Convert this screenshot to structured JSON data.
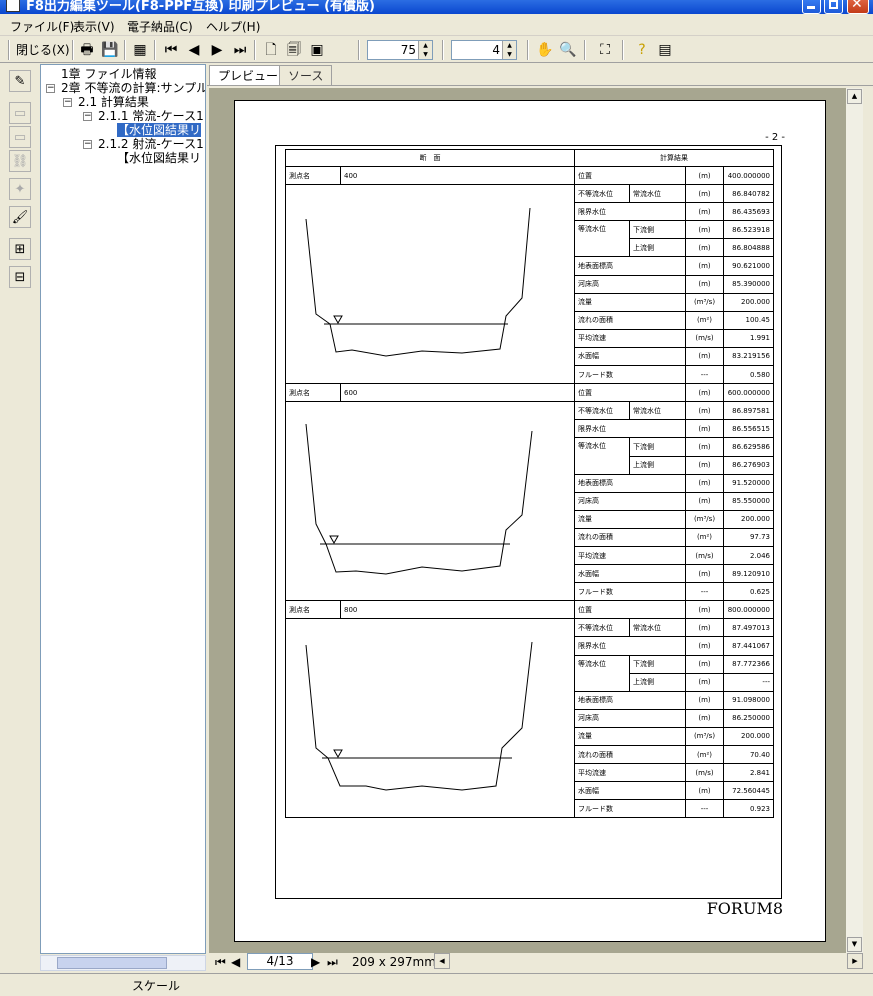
{
  "window": {
    "title": "F8出力編集ツール(F8-PPF互換) 印刷プレビュー (有償版)"
  },
  "menu": [
    "ファイル(F)",
    "表示(V)",
    "電子納品(C)",
    "ヘルプ(H)"
  ],
  "toolbar": {
    "close_label": "閉じる(X)",
    "zoom_value": "75",
    "pages_value": "4"
  },
  "tree": [
    {
      "label": "1章 ファイル情報"
    },
    {
      "label": "2章 不等流の計算:サンプル"
    },
    {
      "label": "2.1 計算結果"
    },
    {
      "label": "2.1.1 常流-ケース1"
    },
    {
      "label": "【水位図結果リ"
    },
    {
      "label": "2.1.2 射流-ケース1"
    },
    {
      "label": "【水位図結果リ"
    }
  ],
  "tabs": {
    "preview": "プレビュー",
    "source": "ソース"
  },
  "nav": {
    "page": "4/13",
    "paper": "209 x 297mm"
  },
  "status": {
    "text": "スケール"
  },
  "report": {
    "page_num": "- 2 -",
    "headers": {
      "section": "断　面",
      "result": "計算結果"
    },
    "station_label": "測点名",
    "logo": "FORUM8",
    "labels": {
      "position": "位置",
      "nonuniform": "不等流水位",
      "normal": "常流水位",
      "critical": "限界水位",
      "uniform": "等流水位",
      "downstream": "下流側",
      "upstream": "上流側",
      "ground": "地表面標高",
      "bed": "河床高",
      "discharge": "流量",
      "area": "流れの面積",
      "velocity": "平均流速",
      "width": "水面幅",
      "froude": "フルード数"
    },
    "units": {
      "m": "(m)",
      "m3s": "(m³/s)",
      "m2": "(m²)",
      "ms": "(m/s)",
      "none": "---"
    },
    "sections": [
      {
        "station": "400",
        "position": "400.000000",
        "nonuniform": "86.840782",
        "critical": "86.435693",
        "down": "86.523918",
        "up": "86.804888",
        "ground": "90.621000",
        "bed": "85.390000",
        "discharge": "200.000",
        "area": "100.45",
        "velocity": "1.991",
        "width": "83.219156",
        "froude": "0.580"
      },
      {
        "station": "600",
        "position": "600.000000",
        "nonuniform": "86.897581",
        "critical": "86.556515",
        "down": "86.629586",
        "up": "86.276903",
        "ground": "91.520000",
        "bed": "85.550000",
        "discharge": "200.000",
        "area": "97.73",
        "velocity": "2.046",
        "width": "89.120910",
        "froude": "0.625"
      },
      {
        "station": "800",
        "position": "800.000000",
        "nonuniform": "87.497013",
        "critical": "87.441067",
        "down": "87.772366",
        "up": "---",
        "ground": "91.098000",
        "bed": "86.250000",
        "discharge": "200.000",
        "area": "70.40",
        "velocity": "2.841",
        "width": "72.560445",
        "froude": "0.923"
      }
    ]
  }
}
